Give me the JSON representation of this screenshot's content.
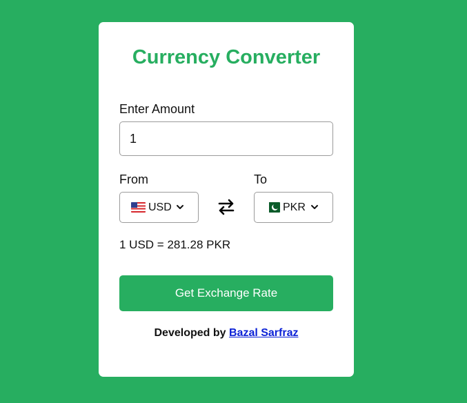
{
  "app": {
    "title": "Currency Converter"
  },
  "amount": {
    "label": "Enter Amount",
    "value": "1"
  },
  "from": {
    "label": "From",
    "code": "USD",
    "flag": "us-flag-icon"
  },
  "to": {
    "label": "To",
    "code": "PKR",
    "flag": "pk-flag-icon"
  },
  "swap": {
    "icon": "swap-arrows-icon"
  },
  "rate": {
    "text": "1 USD = 281.28 PKR"
  },
  "button": {
    "label": "Get Exchange Rate"
  },
  "footer": {
    "prefix": "Developed by",
    "author": "Bazal Sarfraz"
  },
  "colors": {
    "accent": "#27ae60",
    "link": "#0b21d6",
    "card": "#ffffff"
  }
}
